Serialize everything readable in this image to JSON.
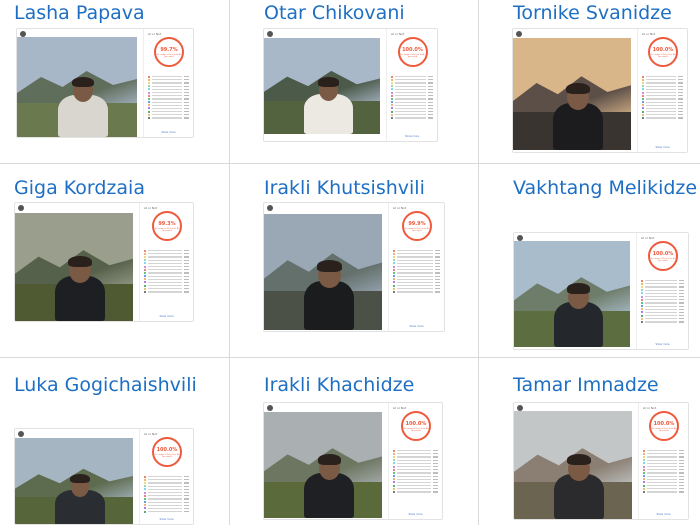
{
  "people": [
    {
      "name": "Lasha Papava",
      "score": "99.7%",
      "sky": "#a8b7c7",
      "mtn": "#5f6d5b",
      "grass": "#6b7a4e",
      "shirt": "#d9d6d0"
    },
    {
      "name": "Otar Chikovani",
      "score": "100.0%",
      "sky": "#a9b8c9",
      "mtn": "#4c5a4a",
      "grass": "#53633f",
      "shirt": "#ece9e3"
    },
    {
      "name": "Tornike Svanidze",
      "score": "100.0%",
      "sky": "#d9b58a",
      "mtn": "#5c4f48",
      "grass": "#3a3431",
      "shirt": "#1c1c1f"
    },
    {
      "name": "Giga Kordzaia",
      "score": "99.3%",
      "sky": "#9a9e8c",
      "mtn": "#55614a",
      "grass": "#4f5a33",
      "shirt": "#1d1f22"
    },
    {
      "name": "Irakli Khutsishvili",
      "score": "99.9%",
      "sky": "#9aa7b4",
      "mtn": "#63706b",
      "grass": "#4b5147",
      "shirt": "#1b1c1e"
    },
    {
      "name": "Vakhtang Melikidze",
      "score": "100.0%",
      "sky": "#a9bccb",
      "mtn": "#6e7d6a",
      "grass": "#5c6e3f",
      "shirt": "#24272b"
    },
    {
      "name": "Luka Gogichaishvili",
      "score": "100.0%",
      "sky": "#a6b5c2",
      "mtn": "#5d6b4e",
      "grass": "#56663a",
      "shirt": "#2a2d31"
    },
    {
      "name": "Irakli Khachidze",
      "score": "100.0%",
      "sky": "#aab0b2",
      "mtn": "#6c7661",
      "grass": "#5b6a3a",
      "shirt": "#1f2024"
    },
    {
      "name": "Tamar Imnadze",
      "score": "100.0%",
      "sky": "#c3c6c7",
      "mtn": "#8a7f72",
      "grass": "#6a6451",
      "shirt": "#2b2b2e"
    }
  ],
  "panel_title": "AI or Not",
  "gauge_sub": "The image is likely to be AI-generated",
  "more_label": "Show more",
  "gauge_color": "#ef5a3c",
  "name_color": "#1e6fc4"
}
